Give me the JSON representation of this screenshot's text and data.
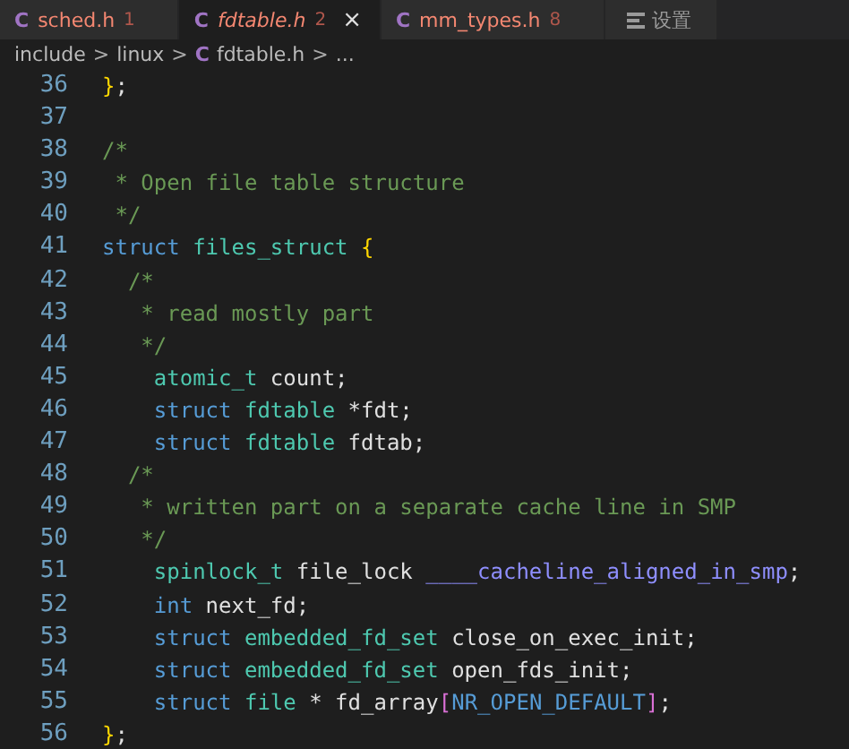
{
  "tabs": [
    {
      "kind": "file",
      "icon": "C",
      "name": "sched.h",
      "badge": "1",
      "selected": false
    },
    {
      "kind": "file",
      "icon": "C",
      "name": "fdtable.h",
      "badge": "2",
      "selected": true,
      "close": "×"
    },
    {
      "kind": "file",
      "icon": "C",
      "name": "mm_types.h",
      "badge": "8",
      "selected": false
    },
    {
      "kind": "settings",
      "name": "设置",
      "selected": false
    }
  ],
  "breadcrumb": [
    {
      "kind": "folder",
      "label": "include"
    },
    {
      "kind": "folder",
      "label": "linux"
    },
    {
      "kind": "file",
      "icon": "C",
      "label": "fdtable.h"
    },
    {
      "kind": "more",
      "label": "..."
    }
  ],
  "breadcrumb_separator": ">",
  "lines": [
    {
      "number": "36",
      "tokens": [
        {
          "kind": "brace",
          "t": "}"
        },
        {
          "kind": "plain",
          "t": ";"
        }
      ]
    },
    {
      "number": "37"
    },
    {
      "number": "38",
      "tokens": [
        {
          "kind": "comment",
          "t": "/*"
        }
      ]
    },
    {
      "number": "39",
      "tokens": [
        {
          "kind": "comment",
          "t": " * Open file table structure"
        }
      ]
    },
    {
      "number": "40",
      "tokens": [
        {
          "kind": "comment",
          "t": " */"
        }
      ]
    },
    {
      "number": "41",
      "tokens": [
        {
          "kind": "kw",
          "t": "struct"
        },
        {
          "kind": "type",
          "t": " files_struct"
        },
        {
          "kind": "brace",
          "t": " {"
        }
      ]
    },
    {
      "number": "42",
      "tokens": [
        {
          "kind": "comment",
          "t": "  /*"
        }
      ]
    },
    {
      "number": "43",
      "tokens": [
        {
          "kind": "comment",
          "t": "   * read mostly part"
        }
      ]
    },
    {
      "number": "44",
      "tokens": [
        {
          "kind": "comment",
          "t": "   */"
        }
      ]
    },
    {
      "number": "45",
      "tokens": [
        {
          "kind": "type",
          "t": "    atomic_t"
        },
        {
          "kind": "plain",
          "t": " count;"
        }
      ]
    },
    {
      "number": "46",
      "tokens": [
        {
          "kind": "kw",
          "t": "    struct"
        },
        {
          "kind": "type",
          "t": " fdtable"
        },
        {
          "kind": "plain",
          "t": " *fdt;"
        }
      ]
    },
    {
      "number": "47",
      "tokens": [
        {
          "kind": "kw",
          "t": "    struct"
        },
        {
          "kind": "type",
          "t": " fdtable"
        },
        {
          "kind": "plain",
          "t": " fdtab;"
        }
      ]
    },
    {
      "number": "48",
      "tokens": [
        {
          "kind": "comment",
          "t": "  /*"
        }
      ]
    },
    {
      "number": "49",
      "tokens": [
        {
          "kind": "comment",
          "t": "   * written part on a separate cache line in SMP"
        }
      ]
    },
    {
      "number": "50",
      "tokens": [
        {
          "kind": "comment",
          "t": "   */"
        }
      ]
    },
    {
      "number": "51",
      "tokens": [
        {
          "kind": "type",
          "t": "    spinlock_t"
        },
        {
          "kind": "plain",
          "t": " file_lock"
        },
        {
          "kind": "macro",
          "t": " ____cacheline_aligned_in_smp"
        },
        {
          "kind": "plain",
          "t": ";"
        }
      ]
    },
    {
      "number": "52",
      "tokens": [
        {
          "kind": "kw",
          "t": "    int"
        },
        {
          "kind": "plain",
          "t": " next_fd;"
        }
      ]
    },
    {
      "number": "53",
      "tokens": [
        {
          "kind": "kw",
          "t": "    struct"
        },
        {
          "kind": "type",
          "t": " embedded_fd_set"
        },
        {
          "kind": "plain",
          "t": " close_on_exec_init;"
        }
      ]
    },
    {
      "number": "54",
      "tokens": [
        {
          "kind": "kw",
          "t": "    struct"
        },
        {
          "kind": "type",
          "t": " embedded_fd_set"
        },
        {
          "kind": "plain",
          "t": " open_fds_init;"
        }
      ]
    },
    {
      "number": "55",
      "tokens": [
        {
          "kind": "kw",
          "t": "    struct"
        },
        {
          "kind": "type",
          "t": " file"
        },
        {
          "kind": "plain",
          "t": " * fd_array"
        },
        {
          "kind": "bracket",
          "t": "["
        },
        {
          "kind": "const",
          "t": "NR_OPEN_DEFAULT"
        },
        {
          "kind": "bracket",
          "t": "]"
        },
        {
          "kind": "plain",
          "t": ";"
        }
      ]
    },
    {
      "number": "56",
      "tokens": [
        {
          "kind": "brace",
          "t": "}"
        },
        {
          "kind": "plain",
          "t": ";"
        }
      ]
    }
  ]
}
